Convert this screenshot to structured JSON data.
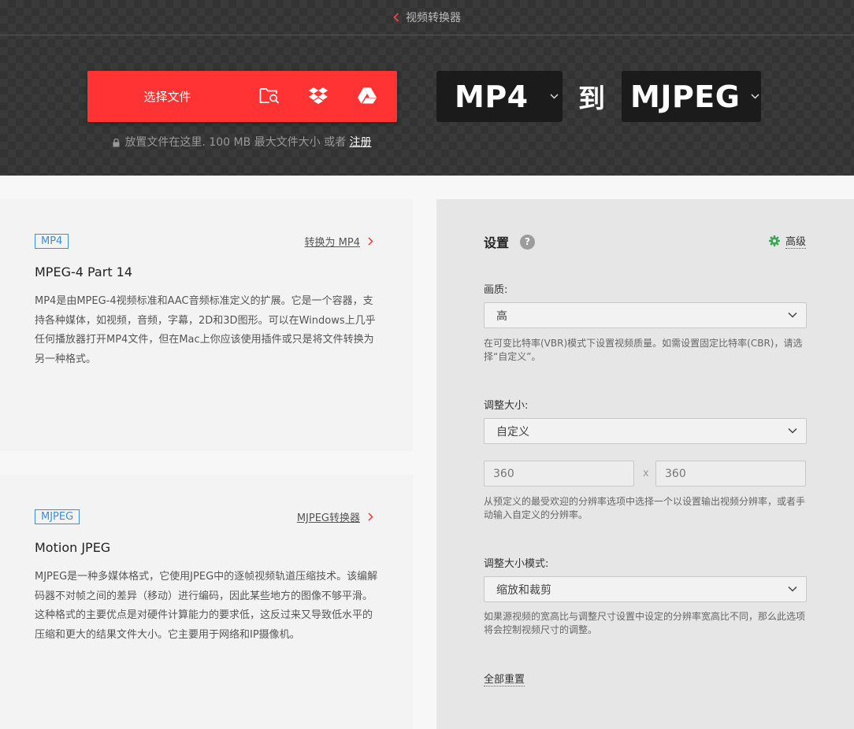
{
  "topbar": {
    "title": "视频转换器"
  },
  "upload": {
    "choose_label": "选择文件",
    "drop_text": "放置文件在这里. 100 MB 最大文件大小 或者",
    "signup_link": "注册"
  },
  "converter": {
    "from": "MP4",
    "to_word": "到",
    "to": "MJPEG"
  },
  "info_blocks": [
    {
      "tag": "MP4",
      "link": "转换为 MP4",
      "title": "MPEG-4 Part 14",
      "description": "MP4是由MPEG-4视频标准和AAC音频标准定义的扩展。它是一个容器，支持各种媒体，如视频，音频，字幕，2D和3D图形。可以在Windows上几乎任何播放器打开MP4文件，但在Mac上你应该使用插件或只是将文件转换为另一种格式。"
    },
    {
      "tag": "MJPEG",
      "link": "MJPEG转换器",
      "title": "Motion JPEG",
      "description": "MJPEG是一种多媒体格式，它使用JPEG中的逐帧视频轨道压缩技术。该编解码器不对帧之间的差异（移动）进行编码，因此某些地方的图像不够平滑。这种格式的主要优点是对硬件计算能力的要求低，这反过来又导致低水平的压缩和更大的结果文件大小。它主要用于网络和IP摄像机。"
    }
  ],
  "settings": {
    "title": "设置",
    "help": "?",
    "advanced": "高级",
    "quality": {
      "label": "画质:",
      "value": "高",
      "hint": "在可变比特率(VBR)模式下设置视频质量。如需设置固定比特率(CBR)，请选择“自定义”。"
    },
    "resize": {
      "label": "调整大小:",
      "value": "自定义",
      "width": "360",
      "sep": "x",
      "height": "360",
      "hint": "从预定义的最受欢迎的分辨率选项中选择一个以设置输出视频分辨率，或者手动输入自定义的分辨率。"
    },
    "resize_mode": {
      "label": "调整大小模式:",
      "value": "缩放和裁剪",
      "hint": "如果源视频的宽高比与调整尺寸设置中设定的分辨率宽高比不同，那么此选项将会控制视频尺寸的调整。"
    },
    "reset": "全部重置"
  },
  "colors": {
    "accent_red": "#ff3333",
    "tag_blue": "#3b8fd8",
    "gear_green": "#3aa757",
    "format_box": "#1b1b1b"
  }
}
